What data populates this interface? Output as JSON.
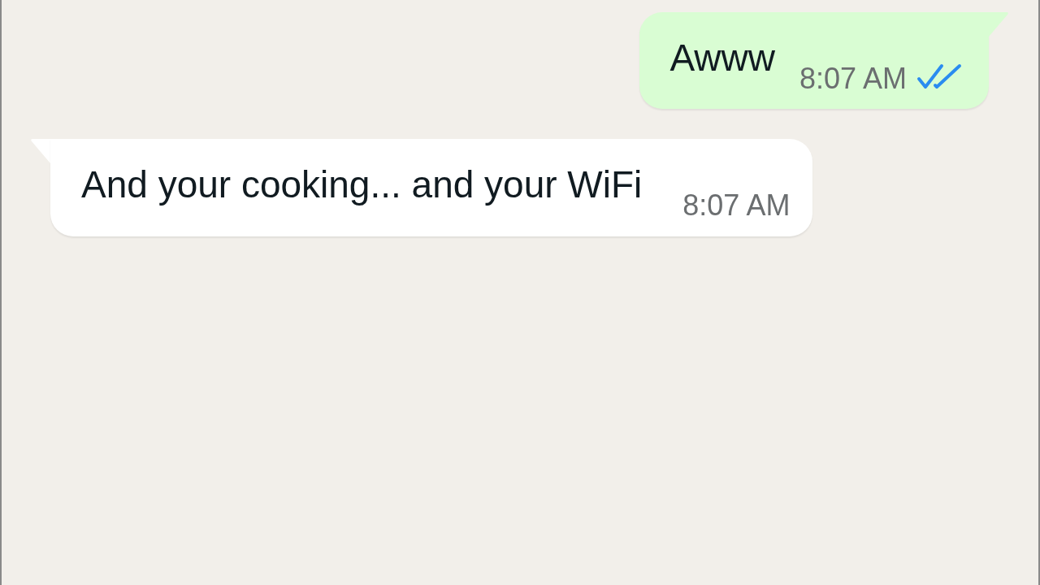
{
  "messages": [
    {
      "kind": "outgoing",
      "text": "Awww",
      "time": "8:07 AM",
      "receipt": {
        "read": true
      }
    },
    {
      "kind": "incoming",
      "text": "And your cooking... and your WiFi",
      "time": "8:07 AM"
    }
  ]
}
